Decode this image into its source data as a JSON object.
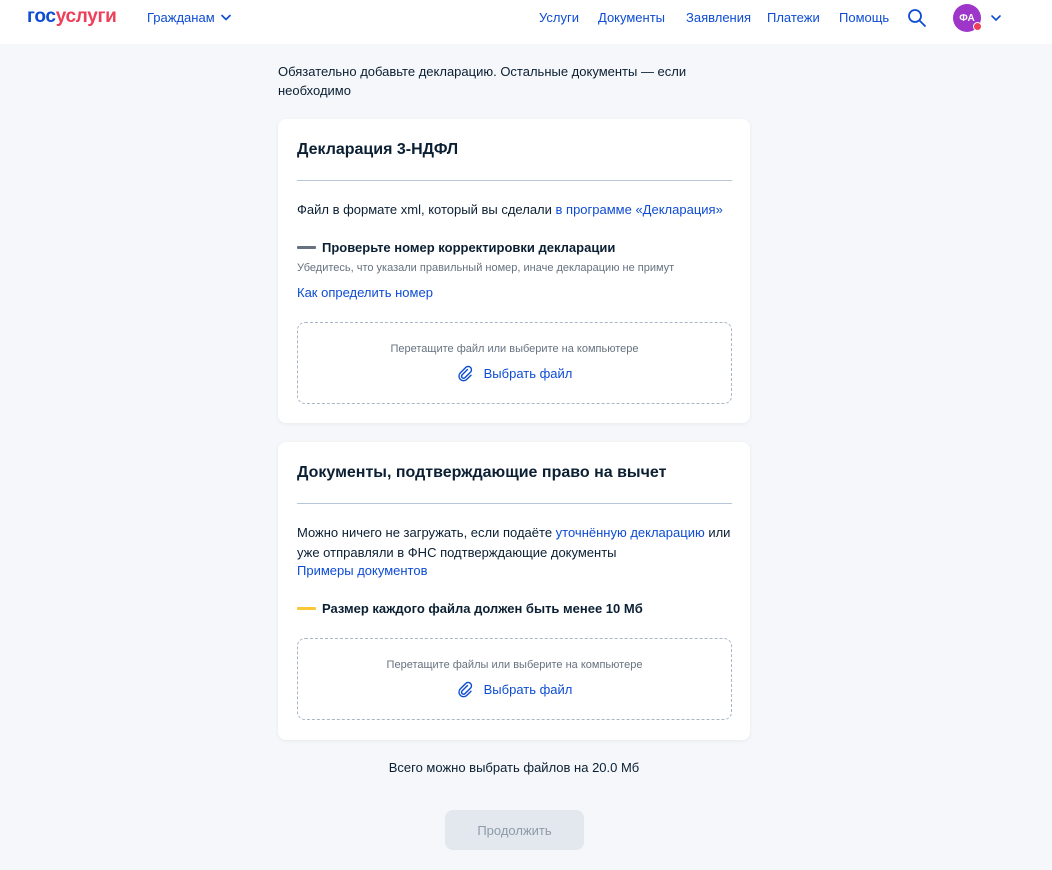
{
  "header": {
    "logo_part1": "гос",
    "logo_part2": "услуги",
    "role_label": "Гражданам",
    "nav": [
      "Услуги",
      "Документы",
      "Заявления",
      "Платежи",
      "Помощь"
    ],
    "avatar_initials": "ФА"
  },
  "intro_text": "Обязательно добавьте декларацию. Остальные документы — если необходимо",
  "declaration_card": {
    "title": "Декларация 3-НДФЛ",
    "description_prefix": "Файл в формате xml, который вы сделали ",
    "description_link": "в программе «Декларация»",
    "alert_title": "Проверьте номер корректировки декларации",
    "alert_subtitle": "Убедитесь, что указали правильный номер, иначе декларацию не примут",
    "how_link": "Как определить номер",
    "dropzone_hint": "Перетащите файл или выберите на компьютере",
    "dropzone_button": "Выбрать файл"
  },
  "documents_card": {
    "title": "Документы, подтверждающие право на вычет",
    "description_prefix": "Можно ничего не загружать, если подаёте ",
    "description_link": "уточнённую декларацию",
    "description_suffix": " или уже отправляли в ФНС подтверждающие документы",
    "examples_link": "Примеры документов",
    "alert_title": "Размер каждого файла должен быть менее 10 Мб",
    "dropzone_hint": "Перетащите файлы или выберите на компьютере",
    "dropzone_button": "Выбрать файл"
  },
  "total_text": "Всего можно выбрать файлов на 20.0 Мб",
  "continue_button": "Продолжить",
  "colors": {
    "brand_blue": "#0d4cd3",
    "brand_red": "#ee3f58",
    "avatar": "#9d36c9",
    "alert_neutral": "#66727f",
    "alert_warning": "#fcc736"
  }
}
